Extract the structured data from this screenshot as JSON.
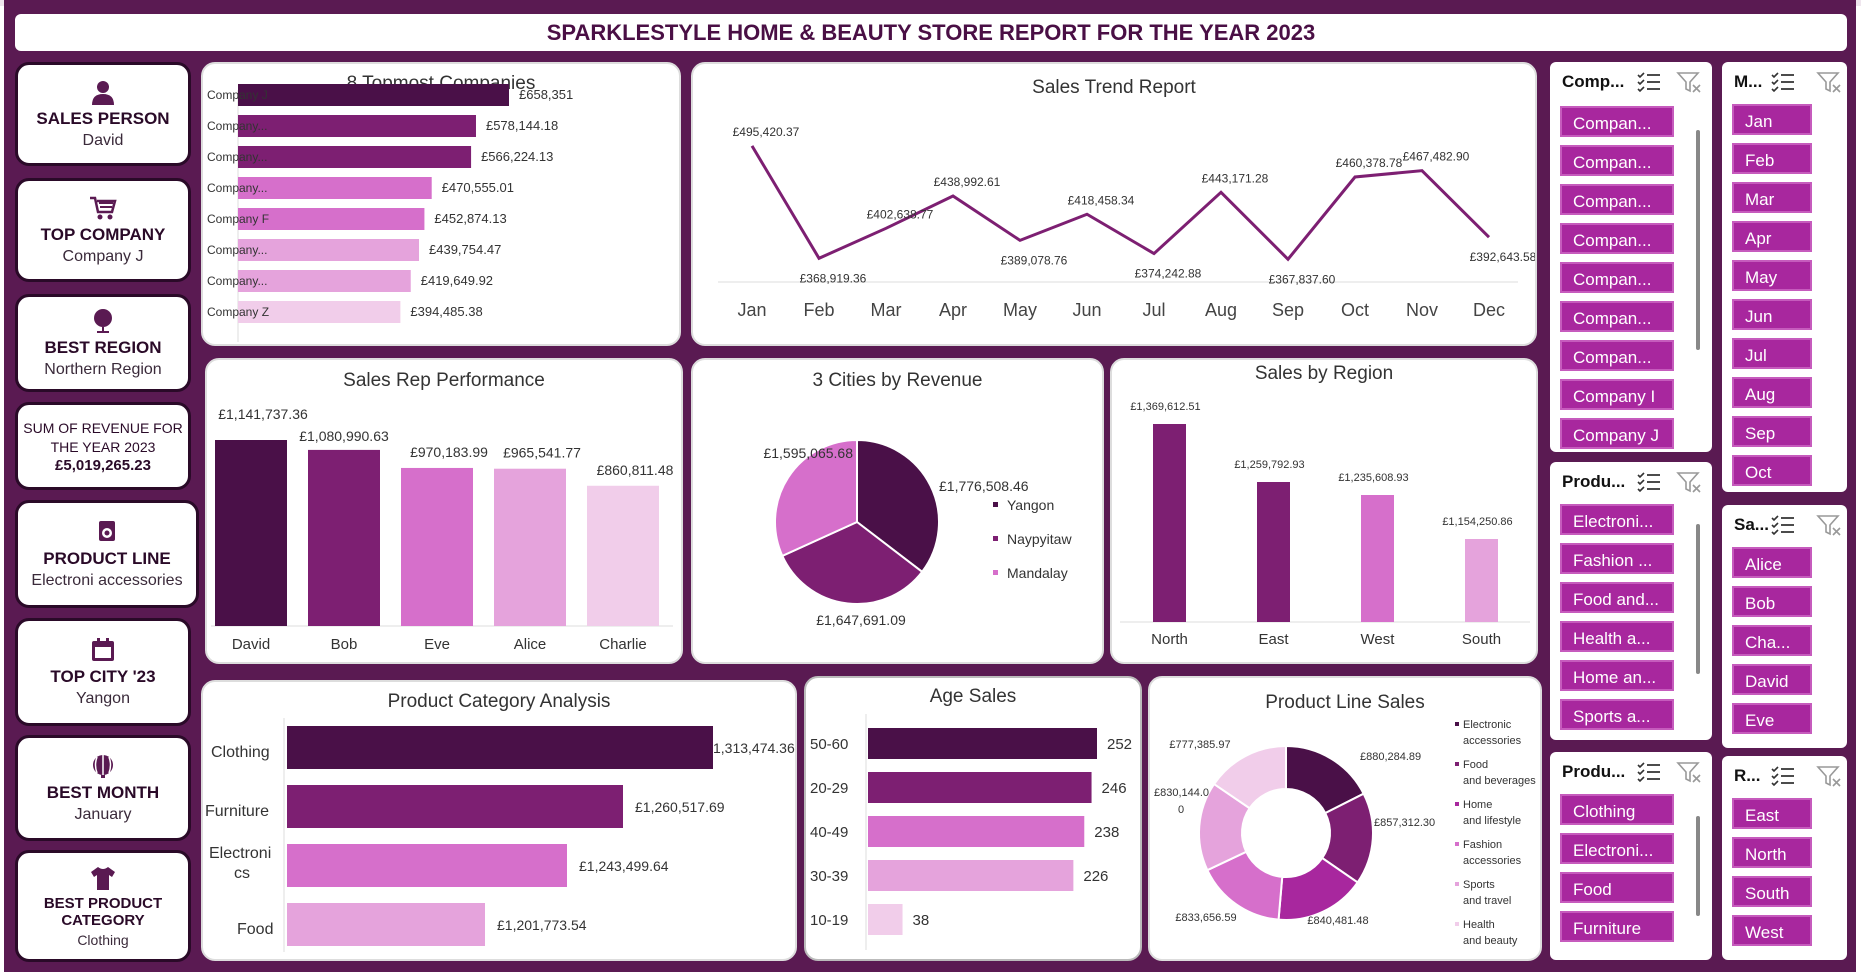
{
  "title": "SPARKLESTYLE HOME & BEAUTY STORE REPORT FOR THE YEAR 2023",
  "kpis": {
    "sales_person": {
      "label": "SALES PERSON",
      "value": "David"
    },
    "top_company": {
      "label": "TOP COMPANY",
      "value": "Company J"
    },
    "best_region": {
      "label": "BEST REGION",
      "value": "Northern Region"
    },
    "revenue": {
      "label_line1": "SUM OF REVENUE FOR",
      "label_line2": "THE YEAR 2023",
      "value": "£5,019,265.23"
    },
    "product_line": {
      "label": "PRODUCT LINE",
      "value": "Electroni accessories"
    },
    "top_city": {
      "label": "TOP CITY '23",
      "value": "Yangon"
    },
    "best_month": {
      "label": "BEST MONTH",
      "value": "January"
    },
    "best_category": {
      "label_line1": "BEST PRODUCT",
      "label_line2": "CATEGORY",
      "value": "Clothing"
    }
  },
  "colors": {
    "dark": "#4a1048",
    "mid": "#7d1f72",
    "pink": "#d66fcb",
    "light": "#e5a3dc",
    "pale": "#f1cdea"
  },
  "chart_data": [
    {
      "id": "top_companies",
      "type": "bar",
      "title": "8 Topmost Companies",
      "categories": [
        "Company J",
        "Company...",
        "Company...",
        "Company...",
        "Company F",
        "Company...",
        "Company...",
        "Company Z"
      ],
      "values": [
        658351,
        578144.18,
        566224.13,
        470555.01,
        452874.13,
        439754.47,
        419649.92,
        394485.38
      ],
      "labels": [
        "£658,351",
        "£578,144.18",
        "£566,224.13",
        "£470,555.01",
        "£452,874.13",
        "£439,754.47",
        "£419,649.92",
        "£394,485.38"
      ]
    },
    {
      "id": "sales_trend",
      "type": "line",
      "title": "Sales Trend Report",
      "categories": [
        "Jan",
        "Feb",
        "Mar",
        "Apr",
        "May",
        "Jun",
        "Jul",
        "Aug",
        "Sep",
        "Oct",
        "Nov",
        "Dec"
      ],
      "values": [
        495420.37,
        368919.36,
        402638.77,
        438992.61,
        389078.76,
        418458.34,
        374242.88,
        443171.28,
        367837.6,
        460378.78,
        467482.9,
        392643.58
      ],
      "labels": [
        "£495,420.37",
        "£368,919.36",
        "£402,638.77",
        "£438,992.61",
        "£389,078.76",
        "£418,458.34",
        "£374,242.88",
        "£443,171.28",
        "£367,837.60",
        "£460,378.78",
        "£467,482.90",
        "£392,643.58"
      ]
    },
    {
      "id": "sales_rep",
      "type": "bar",
      "title": "Sales Rep Performance",
      "categories": [
        "David",
        "Bob",
        "Eve",
        "Alice",
        "Charlie"
      ],
      "values": [
        1141737.36,
        1080990.63,
        970183.99,
        965541.77,
        860811.48
      ],
      "labels": [
        "£1,141,737.36",
        "£1,080,990.63",
        "£970,183.99",
        "£965,541.77",
        "£860,811.48"
      ]
    },
    {
      "id": "cities",
      "type": "pie",
      "title": "3 Cities by Revenue",
      "categories": [
        "Yangon",
        "Naypyitaw",
        "Mandalay"
      ],
      "values": [
        1776508.46,
        1647691.09,
        1595065.68
      ],
      "labels": [
        "£1,776,508.46",
        "£1,647,691.09",
        "£1,595,065.68"
      ]
    },
    {
      "id": "region",
      "type": "bar",
      "title": "Sales by Region",
      "categories": [
        "North",
        "East",
        "West",
        "South"
      ],
      "values": [
        1369612.51,
        1259792.93,
        1235608.93,
        1154250.86
      ],
      "labels": [
        "£1,369,612.51",
        "£1,259,792.93",
        "£1,235,608.93",
        "£1,154,250.86"
      ]
    },
    {
      "id": "category",
      "type": "bar",
      "title": "Product Category Analysis",
      "categories": [
        "Clothing",
        "Furniture",
        "Electroni cs",
        "Food"
      ],
      "values": [
        1313474.36,
        1260517.69,
        1243499.64,
        1201773.54
      ],
      "labels": [
        "1,313,474.36",
        "£1,260,517.69",
        "£1,243,499.64",
        "£1,201,773.54"
      ]
    },
    {
      "id": "age",
      "type": "bar",
      "title": "Age Sales",
      "categories": [
        "50-60",
        "20-29",
        "40-49",
        "30-39",
        "10-19"
      ],
      "values": [
        252,
        246,
        238,
        226,
        38
      ],
      "labels": [
        "252",
        "246",
        "238",
        "226",
        "38"
      ]
    },
    {
      "id": "product_line",
      "type": "pie",
      "title": "Product Line Sales",
      "categories": [
        "Electronic accessories",
        "Food and beverages",
        "Home and lifestyle",
        "Fashion accessories",
        "Sports and travel",
        "Health and beauty"
      ],
      "values": [
        880284.89,
        857312.3,
        840481.48,
        833656.59,
        830144.0,
        777385.97
      ],
      "labels": [
        "£880,284.89",
        "£857,312.30",
        "£840,481.48",
        "£833,656.59",
        "£830,144.0 0",
        "£777,385.97"
      ]
    }
  ],
  "slicers": {
    "company": {
      "title": "Comp...",
      "items": [
        "Compan...",
        "Compan...",
        "Compan...",
        "Compan...",
        "Compan...",
        "Compan...",
        "Compan...",
        "Company I",
        "Company J"
      ]
    },
    "month": {
      "title": "M...",
      "items": [
        "Jan",
        "Feb",
        "Mar",
        "Apr",
        "May",
        "Jun",
        "Jul",
        "Aug",
        "Sep",
        "Oct"
      ]
    },
    "product1": {
      "title": "Produ...",
      "items": [
        "Electroni...",
        "Fashion ...",
        "Food and...",
        "Health a...",
        "Home an...",
        "Sports a..."
      ]
    },
    "salesperson": {
      "title": "Sa...",
      "items": [
        "Alice",
        "Bob",
        "Cha...",
        "David",
        "Eve"
      ]
    },
    "product2": {
      "title": "Produ...",
      "items": [
        "Clothing",
        "Electroni...",
        "Food",
        "Furniture"
      ]
    },
    "region": {
      "title": "R...",
      "items": [
        "East",
        "North",
        "South",
        "West"
      ]
    }
  }
}
